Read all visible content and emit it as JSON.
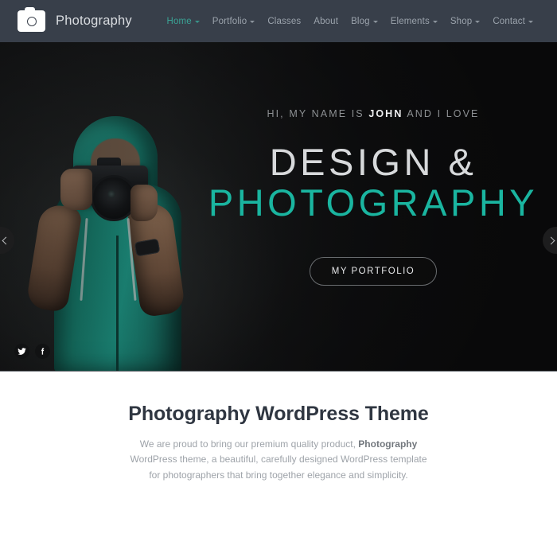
{
  "header": {
    "brand_name": "Photography",
    "logo_icon": "camera-icon",
    "nav": [
      {
        "label": "Home",
        "has_caret": true,
        "active": true
      },
      {
        "label": "Portfolio",
        "has_caret": true,
        "active": false
      },
      {
        "label": "Classes",
        "has_caret": false,
        "active": false
      },
      {
        "label": "About",
        "has_caret": false,
        "active": false
      },
      {
        "label": "Blog",
        "has_caret": true,
        "active": false
      },
      {
        "label": "Elements",
        "has_caret": true,
        "active": false
      },
      {
        "label": "Shop",
        "has_caret": true,
        "active": false
      },
      {
        "label": "Contact",
        "has_caret": true,
        "active": false
      }
    ]
  },
  "hero": {
    "eyebrow_before": "HI, MY NAME IS ",
    "eyebrow_name": "JOHN",
    "eyebrow_after": " AND I LOVE",
    "title_line1": "DESIGN &",
    "title_line2": "PHOTOGRAPHY",
    "cta_label": "MY PORTFOLIO",
    "prev_arrow_icon": "chevron-left-icon",
    "next_arrow_icon": "chevron-right-icon",
    "social": [
      {
        "name": "twitter-icon",
        "label": "Twitter"
      },
      {
        "name": "facebook-icon",
        "label": "Facebook"
      }
    ]
  },
  "intro": {
    "title": "Photography WordPress Theme",
    "text_part1": "We are proud to bring our premium quality product, ",
    "text_bold": "Photography",
    "text_part2": " WordPress theme, a beautiful, carefully designed WordPress template for photographers that bring together elegance and simplicity."
  },
  "colors": {
    "header_bg": "#383f4a",
    "hero_bg": "#0d0d0e",
    "accent_teal": "#1ab5a0",
    "nav_active": "#3aa395",
    "nav_idle": "#9ba3ac",
    "heading_dark": "#2f3641",
    "body_text": "#9ea3a9"
  }
}
